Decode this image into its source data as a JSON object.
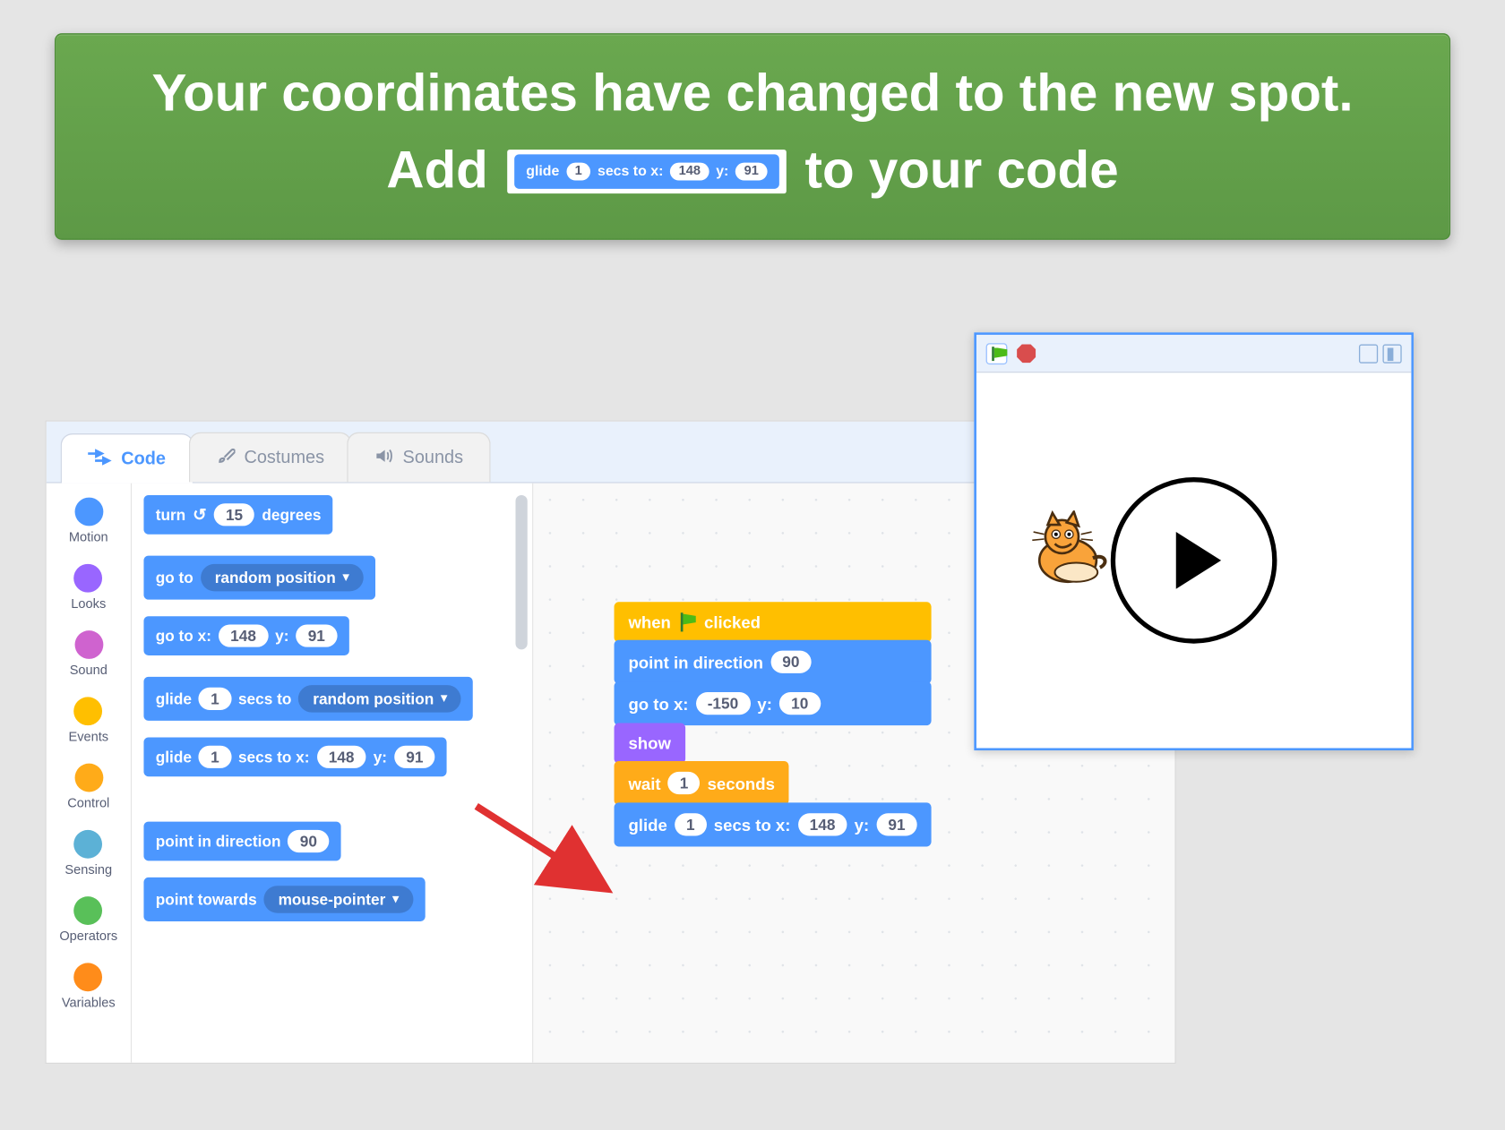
{
  "banner": {
    "line1": "Your coordinates have changed to the new spot.",
    "line2_pre": "Add",
    "line2_post": "to your code",
    "inline_block": {
      "glide": "glide",
      "secs": "1",
      "secs_to_x": "secs to x:",
      "x": "148",
      "y_lbl": "y:",
      "y": "91"
    }
  },
  "tabs": {
    "code": "Code",
    "costumes": "Costumes",
    "sounds": "Sounds"
  },
  "categories": [
    {
      "name": "Motion",
      "color": "#4c97ff"
    },
    {
      "name": "Looks",
      "color": "#9966ff"
    },
    {
      "name": "Sound",
      "color": "#cf63cf"
    },
    {
      "name": "Events",
      "color": "#ffbf00"
    },
    {
      "name": "Control",
      "color": "#ffab19"
    },
    {
      "name": "Sensing",
      "color": "#5cb1d6"
    },
    {
      "name": "Operators",
      "color": "#59c059"
    },
    {
      "name": "Variables",
      "color": "#ff8c1a"
    }
  ],
  "palette": {
    "turn": {
      "label_a": "turn",
      "deg": "15",
      "label_b": "degrees"
    },
    "goto_rand": {
      "label": "go to",
      "opt": "random position"
    },
    "goto_xy": {
      "label": "go to x:",
      "x": "148",
      "ylbl": "y:",
      "y": "91"
    },
    "glide_rand": {
      "g": "glide",
      "s": "1",
      "mid": "secs to",
      "opt": "random position"
    },
    "glide_xy": {
      "g": "glide",
      "s": "1",
      "mid": "secs to x:",
      "x": "148",
      "ylbl": "y:",
      "y": "91"
    },
    "point_dir": {
      "label": "point in direction",
      "v": "90"
    },
    "point_to": {
      "label": "point towards",
      "opt": "mouse-pointer"
    }
  },
  "script": {
    "hat": {
      "a": "when",
      "b": "clicked"
    },
    "point": {
      "label": "point in direction",
      "v": "90"
    },
    "goto": {
      "label": "go to x:",
      "x": "-150",
      "ylbl": "y:",
      "y": "10"
    },
    "show": "show",
    "wait": {
      "a": "wait",
      "v": "1",
      "b": "seconds"
    },
    "glide": {
      "g": "glide",
      "s": "1",
      "mid": "secs to x:",
      "x": "148",
      "ylbl": "y:",
      "y": "91"
    }
  },
  "stage": {}
}
